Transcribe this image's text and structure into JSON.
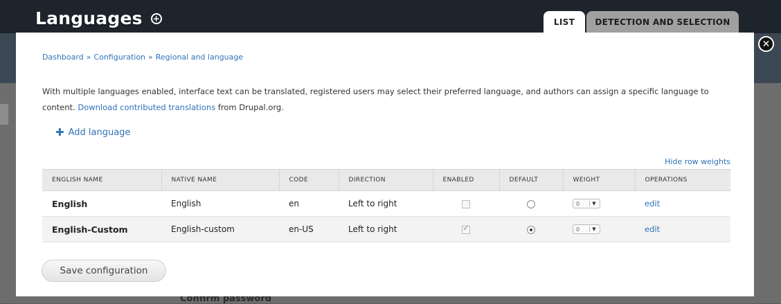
{
  "header": {
    "title": "Languages",
    "tabs": [
      {
        "label": "LIST",
        "active": true
      },
      {
        "label": "DETECTION AND SELECTION",
        "active": false
      }
    ]
  },
  "breadcrumb": [
    "Dashboard",
    "Configuration",
    "Regional and language"
  ],
  "description": {
    "text_before": "With multiple languages enabled, interface text can be translated, registered users may select their preferred language, and authors can assign a specific language to content.",
    "link": "Download contributed translations",
    "text_after": "from Drupal.org."
  },
  "actions": {
    "add_language": "Add language",
    "hide_row_weights": "Hide row weights",
    "save": "Save configuration"
  },
  "table": {
    "headers": [
      "ENGLISH NAME",
      "NATIVE NAME",
      "CODE",
      "DIRECTION",
      "ENABLED",
      "DEFAULT",
      "WEIGHT",
      "OPERATIONS"
    ],
    "rows": [
      {
        "english_name": "English",
        "native_name": "English",
        "code": "en",
        "direction": "Left to right",
        "enabled": false,
        "default": false,
        "weight": "0",
        "operation": "edit"
      },
      {
        "english_name": "English-Custom",
        "native_name": "English-custom",
        "code": "en-US",
        "direction": "Left to right",
        "enabled": true,
        "default": true,
        "weight": "0",
        "operation": "edit"
      }
    ]
  },
  "background": {
    "ghost_text": "Confirm password"
  },
  "colors": {
    "link": "#2f73b8",
    "overlay": "#ffffff"
  }
}
